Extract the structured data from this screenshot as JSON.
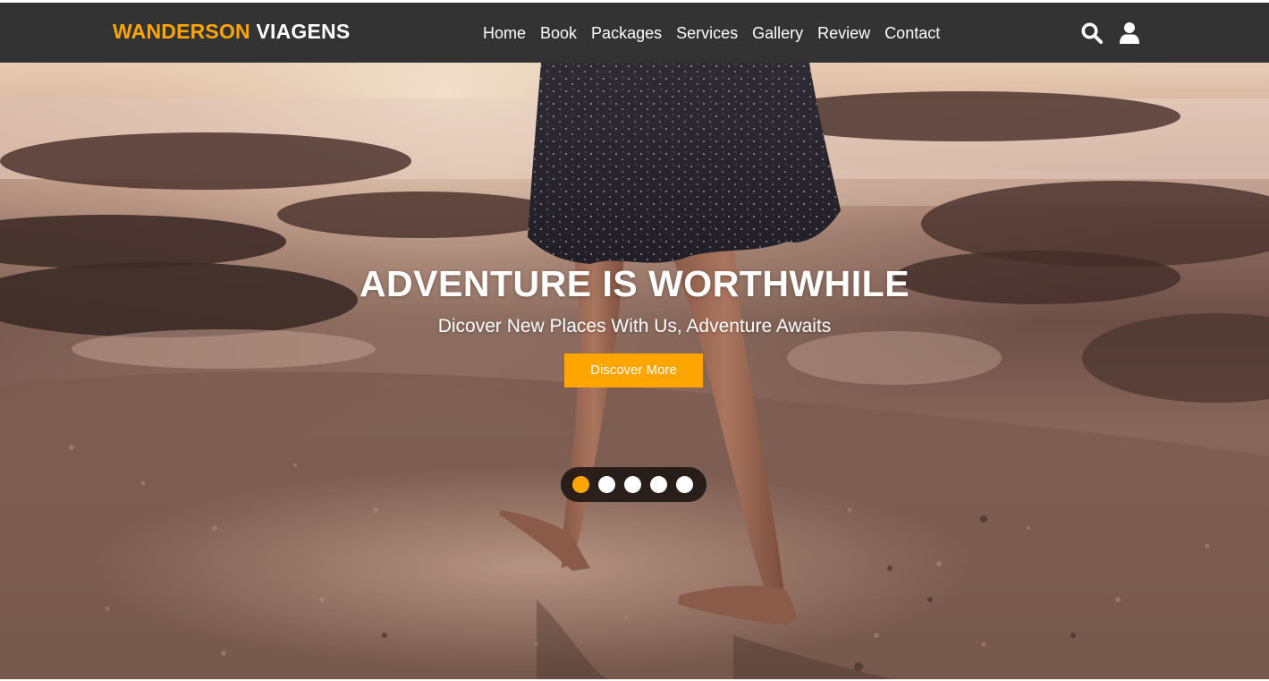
{
  "header": {
    "logo_accent": "WANDERSON",
    "logo_rest": "VIAGENS",
    "nav": [
      {
        "label": "Home"
      },
      {
        "label": "Book"
      },
      {
        "label": "Packages"
      },
      {
        "label": "Services"
      },
      {
        "label": "Gallery"
      },
      {
        "label": "Review"
      },
      {
        "label": "Contact"
      }
    ],
    "icons": [
      "search-icon",
      "user-icon"
    ]
  },
  "hero": {
    "title": "ADVENTURE IS WORTHWHILE",
    "subtitle": "Dicover New Places With Us, Adventure Awaits",
    "button_label": "Discover More",
    "slides_total": 5,
    "active_slide": 1,
    "image": "beach-walk-photo"
  },
  "colors": {
    "accent": "#ffa500",
    "header_bg": "#333333",
    "text_light": "#ffffff"
  }
}
